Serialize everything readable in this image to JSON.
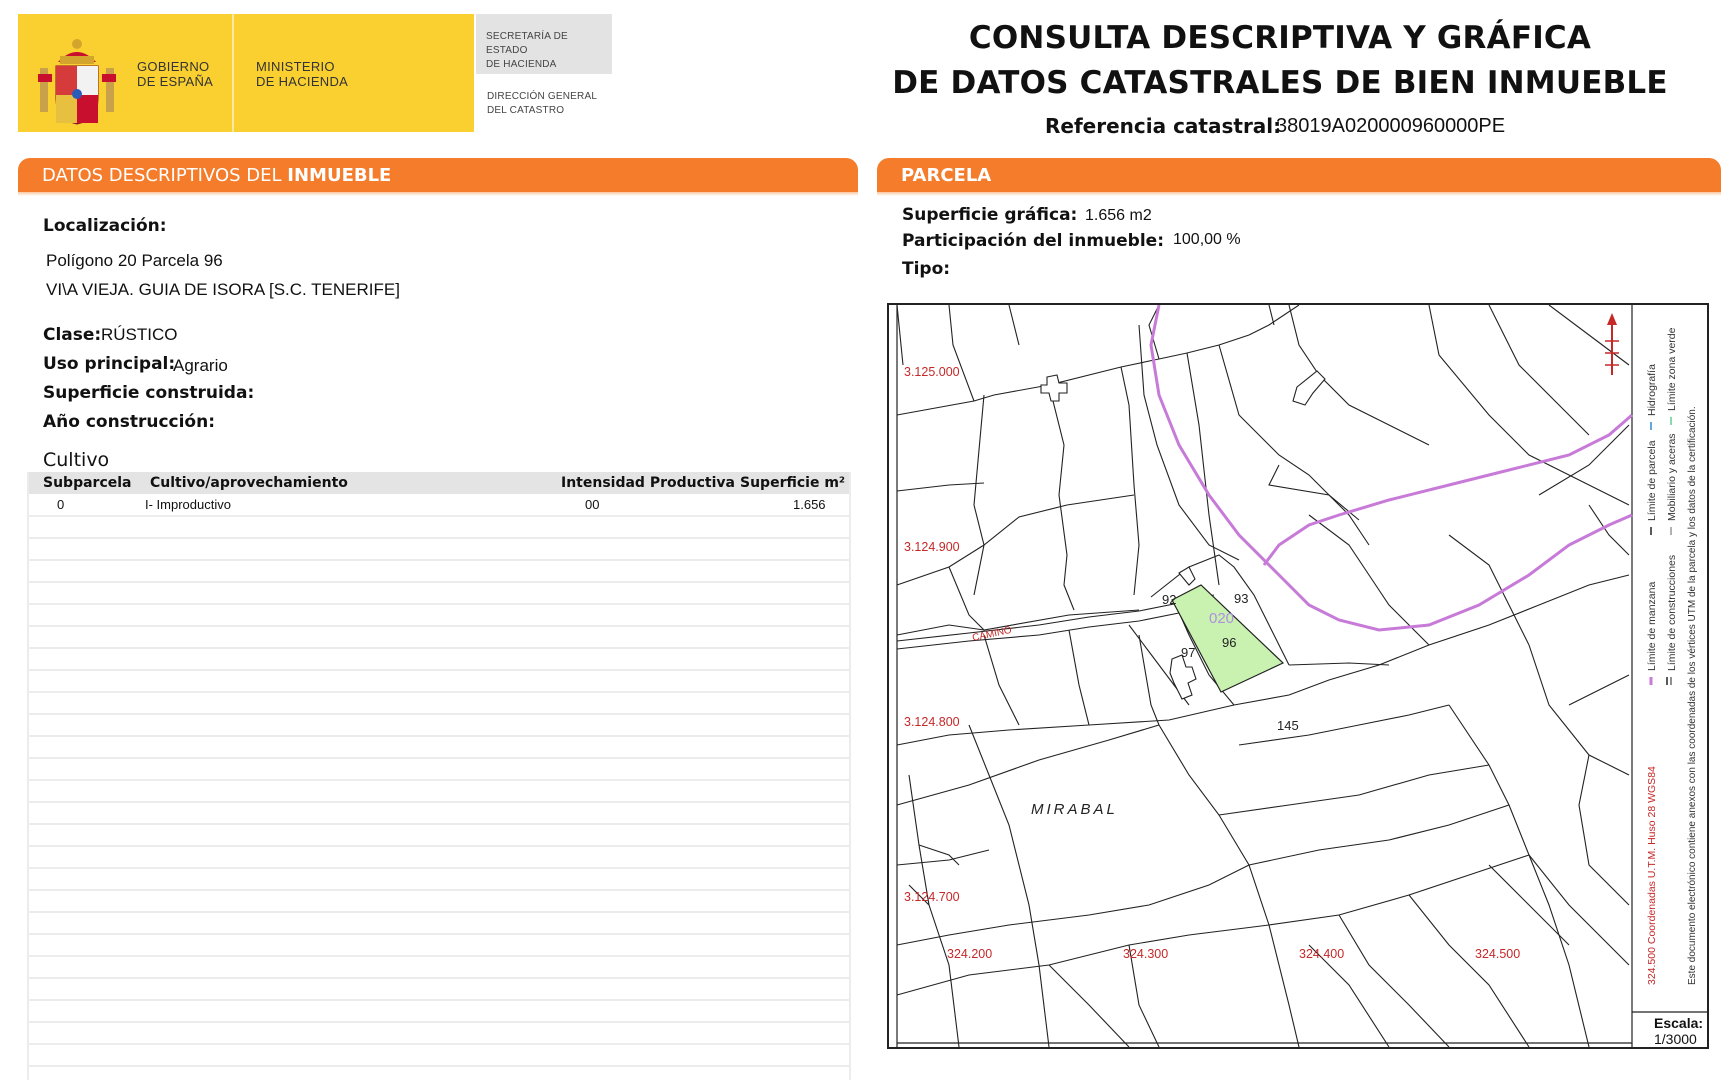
{
  "header": {
    "gob_line1": "GOBIERNO",
    "gob_line2": "DE ESPAÑA",
    "min_line1": "MINISTERIO",
    "min_line2": "DE HACIENDA",
    "sec_line1": "SECRETARÍA DE ESTADO",
    "sec_line2": "DE HACIENDA",
    "dir_line1": "DIRECCIÓN GENERAL",
    "dir_line2": "DEL CATASTRO",
    "title_line1": "CONSULTA DESCRIPTIVA Y GRÁFICA",
    "title_line2": "DE DATOS CATASTRALES DE BIEN INMUEBLE",
    "ref_label": "Referencia catastral:",
    "ref_value": "38019A020000960000PE"
  },
  "colors": {
    "orange": "#f47c2a",
    "yellow": "#f9d030",
    "parcel_green": "#c9f2b0",
    "limit_purple": "#c77ad8"
  },
  "left": {
    "section_title_light": "DATOS DESCRIPTIVOS DEL ",
    "section_title_bold": "INMUEBLE",
    "loc_label": "Localización:",
    "loc_line1": "Polígono 20 Parcela 96",
    "loc_line2": "VI\\A VIEJA. GUIA DE ISORA [S.C. TENERIFE]",
    "clase_label": "Clase:",
    "clase_value": "RÚSTICO",
    "uso_label": "Uso principal:",
    "uso_value": "Agrario",
    "sup_label": "Superficie construida:",
    "anio_label": "Año construcción:",
    "cultivo_title": "Cultivo",
    "table": {
      "headers": [
        "Subparcela",
        "Cultivo/aprovechamiento",
        "Intensidad Productiva",
        "Superficie m²"
      ],
      "rows": [
        [
          "0",
          "I- Improductivo",
          "00",
          "1.656"
        ]
      ]
    }
  },
  "right": {
    "section_title": "PARCELA",
    "sup_label": "Superficie gráfica:",
    "sup_value": "1.656 m2",
    "part_label": "Participación del inmueble:",
    "part_value": "100,00 %",
    "tipo_label": "Tipo:",
    "map": {
      "y_ticks": [
        "3.125.000",
        "3.124.900",
        "3.124.800",
        "3.124.700"
      ],
      "x_ticks": [
        "324.200",
        "324.300",
        "324.400",
        "324.500"
      ],
      "parcel_numbers": [
        "93",
        "92",
        "97",
        "96",
        "145",
        "020"
      ],
      "place_name": "MIRABAL",
      "road_name": "CAMINO",
      "legend": {
        "l1": "Límite de manzana",
        "l2": "Límite de parcela",
        "l3": "Hidrografía",
        "l4": "Límite de construcciones",
        "l5": "Mobiliario y aceras",
        "l6": "Límite zona verde",
        "coords": "324.500 Coordenadas U.T.M. Huso 28 WGS84",
        "note": "Este documento electrónico contiene anexos con las coordenadas de los vértices UTM de la parcela y los datos de la certificación."
      },
      "scale_label": "Escala:",
      "scale_value": "1/3000"
    }
  }
}
